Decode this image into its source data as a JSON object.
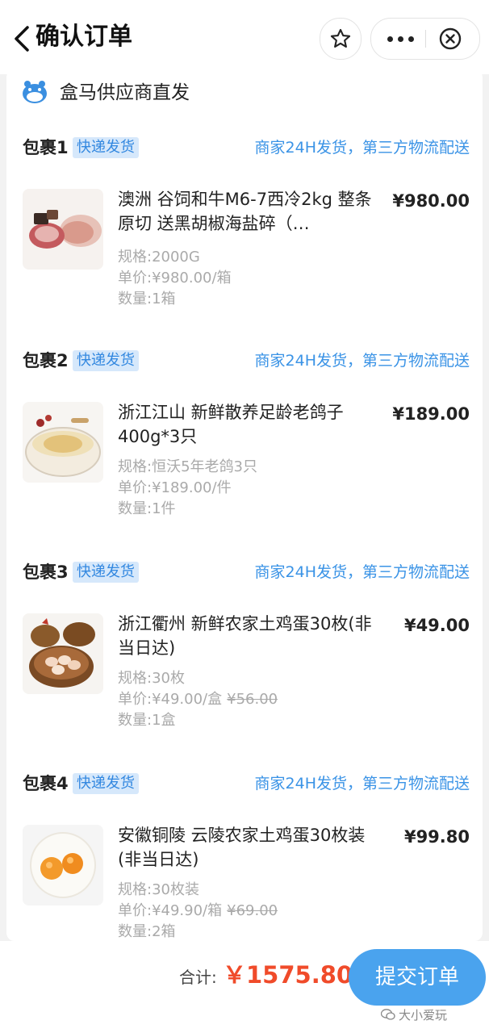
{
  "header": {
    "title": "确认订单"
  },
  "supplier": {
    "name": "盒马供应商直发"
  },
  "packages": [
    {
      "title": "包裹1",
      "badge": "快递发货",
      "shipping": "商家24H发货，第三方物流配送",
      "product_name": "澳洲 谷饲和牛M6-7西冷2kg 整条原切 送黑胡椒海盐碎（…",
      "price": "¥980.00",
      "spec": "规格:2000G",
      "unit_price": "单价:¥980.00/箱",
      "old_price": "",
      "quantity": "数量:1箱"
    },
    {
      "title": "包裹2",
      "badge": "快递发货",
      "shipping": "商家24H发货，第三方物流配送",
      "product_name": "浙江江山 新鲜散养足龄老鸽子400g*3只",
      "price": "¥189.00",
      "spec": "规格:恒沃5年老鸽3只",
      "unit_price": "单价:¥189.00/件",
      "old_price": "",
      "quantity": "数量:1件"
    },
    {
      "title": "包裹3",
      "badge": "快递发货",
      "shipping": "商家24H发货，第三方物流配送",
      "product_name": "浙江衢州 新鲜农家土鸡蛋30枚(非当日达)",
      "price": "¥49.00",
      "spec": "规格:30枚",
      "unit_price": "单价:¥49.00/盒",
      "old_price": "¥56.00",
      "quantity": "数量:1盒"
    },
    {
      "title": "包裹4",
      "badge": "快递发货",
      "shipping": "商家24H发货，第三方物流配送",
      "product_name": "安徽铜陵 云陵农家土鸡蛋30枚装(非当日达)",
      "price": "¥99.80",
      "spec": "规格:30枚装",
      "unit_price": "单价:¥49.90/箱",
      "old_price": "¥69.00",
      "quantity": "数量:2箱"
    }
  ],
  "footer": {
    "total_label": "合计:",
    "total_value": "￥1575.80",
    "submit_label": "提交订单",
    "watermark": "大小爱玩"
  },
  "colors": {
    "accent": "#4aa3ee",
    "price_red": "#f04b2a",
    "badge_bg": "#d6e8fb",
    "link_blue": "#3a93e6"
  }
}
